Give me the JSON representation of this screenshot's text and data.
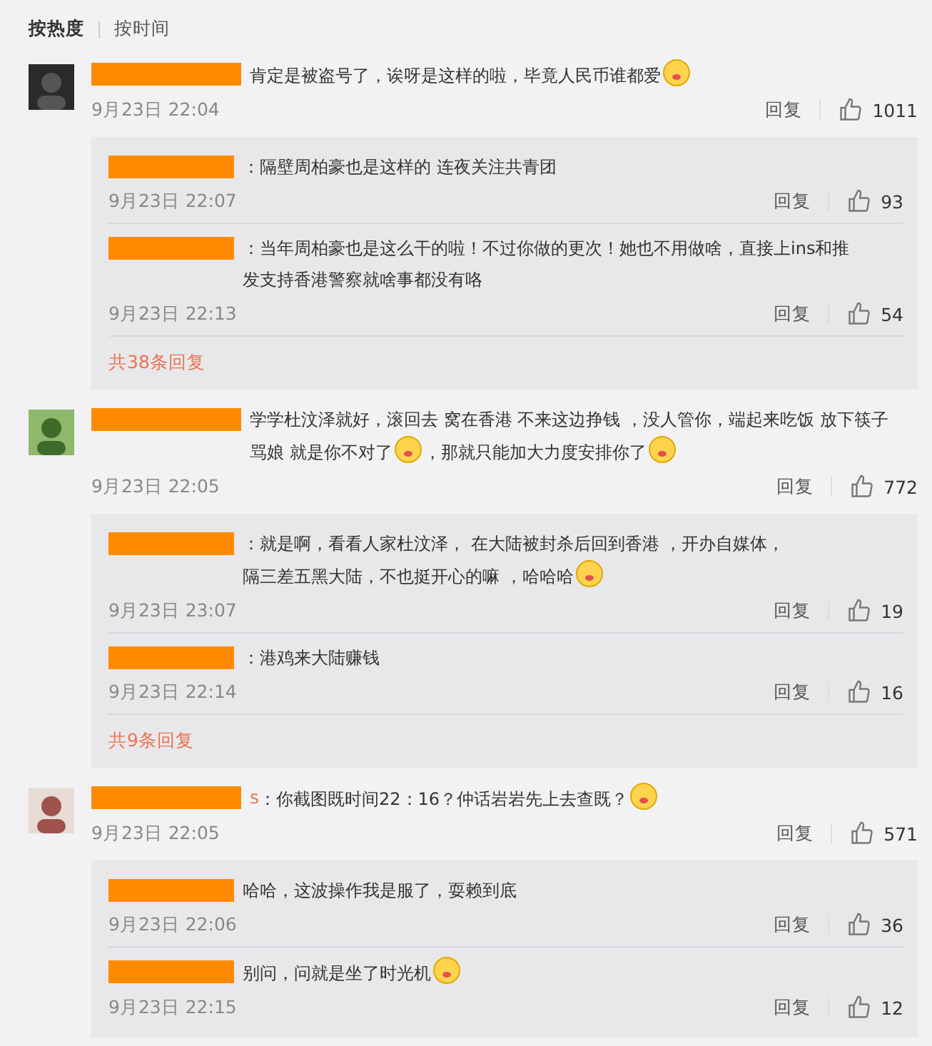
{
  "sort_tabs": [
    {
      "label": "按热度",
      "selected": true
    },
    {
      "label": "按时间",
      "selected": false
    }
  ],
  "comments": [
    {
      "parts": [
        {
          "kind": "text",
          "text": "肯定是被盗号了，诶呀是这样的啦，毕竟人民币谁都爱"
        },
        {
          "kind": "emoji"
        }
      ],
      "time": "9月23日 22:04",
      "reply_label": "回复",
      "likes": "1011",
      "replies": [
        {
          "parts": [
            {
              "kind": "text",
              "text": "：隔壁周柏豪也是这样的 连夜关注共青团"
            }
          ],
          "time": "9月23日 22:07",
          "reply_label": "回复",
          "likes": "93"
        },
        {
          "parts": [
            {
              "kind": "text",
              "text": "：当年周柏豪也是这么干的啦！不过你做的更次！她也不用做啥，直接上ins和推"
            },
            {
              "kind": "break"
            },
            {
              "kind": "text",
              "text": "发支持香港警察就啥事都没有咯"
            }
          ],
          "time": "9月23日 22:13",
          "reply_label": "回复",
          "likes": "54"
        }
      ],
      "more": "共38条回复"
    },
    {
      "parts": [
        {
          "kind": "text",
          "text": "学学杜汶泽就好，滚回去 窝在香港 不来这边挣钱 ，没人管你，端起来吃饭 放下筷子"
        },
        {
          "kind": "break"
        },
        {
          "kind": "text",
          "text": "骂娘 就是你不对了"
        },
        {
          "kind": "emoji"
        },
        {
          "kind": "text",
          "text": "，那就只能加大力度安排你了"
        },
        {
          "kind": "emoji"
        }
      ],
      "time": "9月23日 22:05",
      "reply_label": "回复",
      "likes": "772",
      "replies": [
        {
          "parts": [
            {
              "kind": "text",
              "text": "：就是啊，看看人家杜汶泽， 在大陆被封杀后回到香港 ，开办自媒体，"
            },
            {
              "kind": "break"
            },
            {
              "kind": "text",
              "text": "隔三差五黑大陆，不也挺开心的嘛 ，哈哈哈"
            },
            {
              "kind": "emoji"
            }
          ],
          "time": "9月23日 23:07",
          "reply_label": "回复",
          "likes": "19"
        },
        {
          "parts": [
            {
              "kind": "text",
              "text": "：港鸡来大陆赚钱"
            }
          ],
          "time": "9月23日 22:14",
          "reply_label": "回复",
          "likes": "16"
        }
      ],
      "more": "共9条回复"
    },
    {
      "name_visible": "s",
      "parts": [
        {
          "kind": "text",
          "text": "：你截图既时间22：16？仲话岩岩先上去查既？"
        },
        {
          "kind": "emoji"
        }
      ],
      "time": "9月23日 22:05",
      "reply_label": "回复",
      "likes": "571",
      "replies": [
        {
          "parts": [
            {
              "kind": "text",
              "text": "哈哈，这波操作我是服了，耍赖到底"
            }
          ],
          "time": "9月23日 22:06",
          "reply_label": "回复",
          "likes": "36"
        },
        {
          "parts": [
            {
              "kind": "text",
              "text": "别问，问就是坐了时光机"
            },
            {
              "kind": "emoji"
            }
          ],
          "time": "9月23日 22:15",
          "reply_label": "回复",
          "likes": "12"
        }
      ]
    }
  ]
}
